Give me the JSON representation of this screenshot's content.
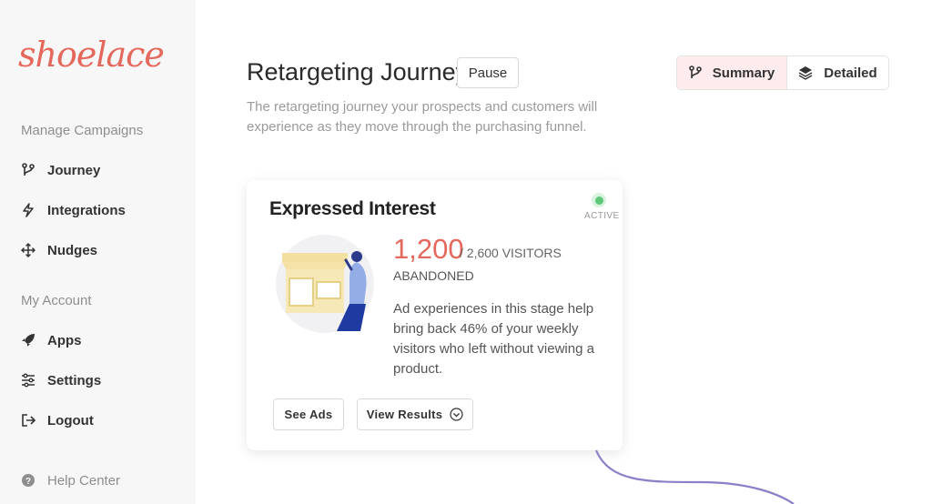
{
  "app": {
    "logo_text": "shoelace",
    "brand_color": "#e4685c"
  },
  "sidebar": {
    "section_campaigns": "Manage Campaigns",
    "section_account": "My Account",
    "items": [
      {
        "label": "Journey",
        "icon": "branch-icon"
      },
      {
        "label": "Integrations",
        "icon": "bolt-icon"
      },
      {
        "label": "Nudges",
        "icon": "move-arrows-icon"
      },
      {
        "label": "Apps",
        "icon": "rocket-icon"
      },
      {
        "label": "Settings",
        "icon": "sliders-icon"
      },
      {
        "label": "Logout",
        "icon": "logout-icon"
      }
    ],
    "help": {
      "label": "Help Center",
      "icon": "help-icon"
    }
  },
  "header": {
    "title": "Retargeting Journey",
    "pause_label": "Pause",
    "description": "The retargeting journey your prospects and customers will experience as they move through the purchasing funnel."
  },
  "view_toggle": {
    "summary_label": "Summary",
    "detailed_label": "Detailed",
    "selected": "Summary"
  },
  "stage_card": {
    "title": "Expressed Interest",
    "status": "ACTIVE",
    "status_color": "#5fc878",
    "count": "1,200",
    "total": "/ 2,600 VISITORS",
    "metric_label": "ABANDONED",
    "body": "Ad experiences in this stage help bring back 46% of your weekly visitors who left without viewing a product.",
    "see_ads_label": "See Ads",
    "view_results_label": "View Results"
  }
}
